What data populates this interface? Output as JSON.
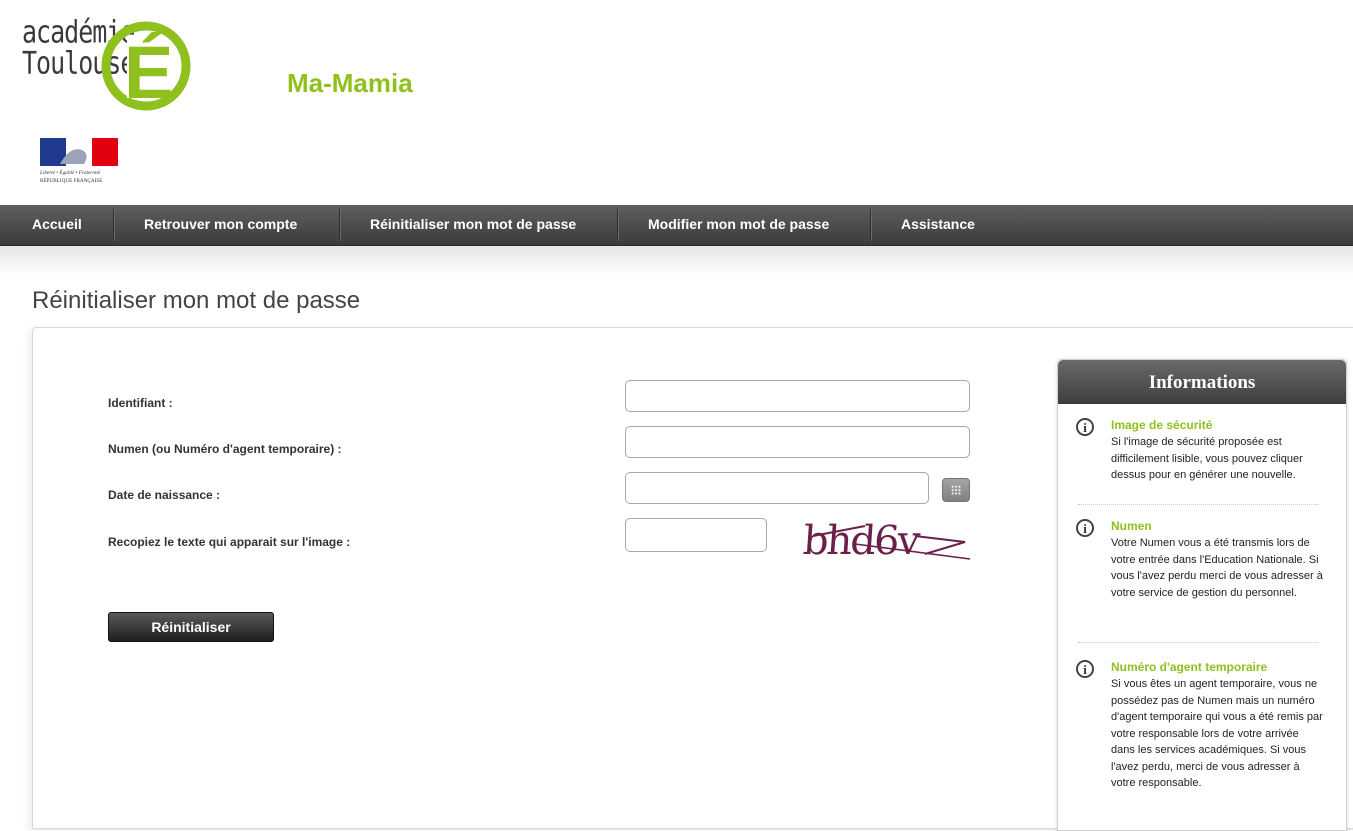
{
  "header": {
    "logo_line1": "académie",
    "logo_line2": "Toulouse",
    "logo_letter": "É",
    "site_title": "Ma-Mamia",
    "rf_motto": "Liberté • Égalité • Fraternité",
    "rf_name": "RÉPUBLIQUE FRANÇAISE"
  },
  "nav": {
    "items": [
      {
        "label": "Accueil"
      },
      {
        "label": "Retrouver mon compte"
      },
      {
        "label": "Réinitialiser mon mot de passe"
      },
      {
        "label": "Modifier mon mot de passe"
      },
      {
        "label": "Assistance"
      }
    ]
  },
  "page": {
    "title": "Réinitialiser mon mot de passe"
  },
  "form": {
    "identifiant_label": "Identifiant :",
    "identifiant_value": "",
    "numen_label": "Numen (ou Numéro d'agent temporaire) :",
    "numen_value": "",
    "birthdate_label": "Date de naissance :",
    "birthdate_value": "",
    "captcha_label": "Recopiez le texte qui apparait sur l'image :",
    "captcha_value": "",
    "captcha_text": "bhd6v",
    "submit_label": "Réinitialiser"
  },
  "info": {
    "title": "Informations",
    "items": [
      {
        "title": "Image de sécurité",
        "text": "Si l'image de sécurité proposée est difficilement lisible, vous pouvez cliquer dessus pour en générer une nouvelle."
      },
      {
        "title": "Numen",
        "text": "Votre Numen vous a été transmis lors de votre entrée dans l'Education Nationale. Si vous l'avez perdu merci de vous adresser à votre service de gestion du personnel."
      },
      {
        "title": "Numéro d'agent temporaire",
        "text": "Si vous êtes un agent temporaire, vous ne possédez pas de Numen mais un numéro d'agent temporaire qui vous a été remis par votre responsable lors de votre arrivée dans les services académiques. Si vous l'avez perdu, merci de vous adresser à votre responsable."
      }
    ]
  },
  "colors": {
    "accent_green": "#8fc01e",
    "nav_dark": "#3b3b3b",
    "captcha_text": "#6b1f4a"
  },
  "icons": {
    "info": "info-circle-icon",
    "calendar": "calendar-grid-icon"
  }
}
